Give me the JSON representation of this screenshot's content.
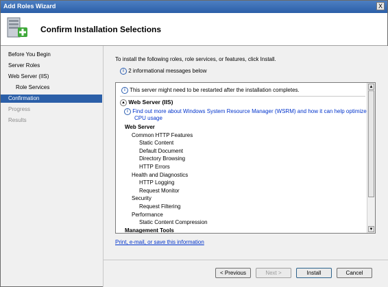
{
  "window": {
    "title": "Add Roles Wizard",
    "close_glyph": "X"
  },
  "header": {
    "title": "Confirm Installation Selections",
    "icon": "server-add-icon"
  },
  "steps": [
    {
      "label": "Before You Begin",
      "state": "normal"
    },
    {
      "label": "Server Roles",
      "state": "normal"
    },
    {
      "label": "Web Server (IIS)",
      "state": "normal"
    },
    {
      "label": "Role Services",
      "state": "sub"
    },
    {
      "label": "Confirmation",
      "state": "active"
    },
    {
      "label": "Progress",
      "state": "disabled"
    },
    {
      "label": "Results",
      "state": "disabled"
    }
  ],
  "main": {
    "intro": "To install the following roles, role services, or features, click Install.",
    "info_summary": "2 informational messages below",
    "restart_notice": "This server might need to be restarted after the installation completes.",
    "role_header": "Web Server (IIS)",
    "wsrm_link_1": "Find out more about Windows System Resource Manager (WSRM) and how it can help optimize",
    "wsrm_link_2": "CPU usage",
    "tree": [
      {
        "text": "Web Server",
        "level": 0,
        "bold": true
      },
      {
        "text": "Common HTTP Features",
        "level": 1
      },
      {
        "text": "Static Content",
        "level": 2
      },
      {
        "text": "Default Document",
        "level": 2
      },
      {
        "text": "Directory Browsing",
        "level": 2
      },
      {
        "text": "HTTP Errors",
        "level": 2
      },
      {
        "text": "Health and Diagnostics",
        "level": 1
      },
      {
        "text": "HTTP Logging",
        "level": 2
      },
      {
        "text": "Request Monitor",
        "level": 2
      },
      {
        "text": "Security",
        "level": 1
      },
      {
        "text": "Request Filtering",
        "level": 2
      },
      {
        "text": "Performance",
        "level": 1
      },
      {
        "text": "Static Content Compression",
        "level": 2
      },
      {
        "text": "Management Tools",
        "level": 0,
        "bold": true
      }
    ],
    "print_link": "Print, e-mail, or save this information"
  },
  "footer": {
    "previous": "< Previous",
    "next": "Next >",
    "install": "Install",
    "cancel": "Cancel"
  }
}
